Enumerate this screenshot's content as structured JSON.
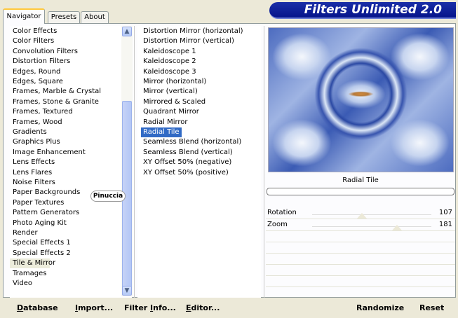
{
  "tabs": [
    {
      "label": "Navigator",
      "active": true
    },
    {
      "label": "Presets",
      "active": false
    },
    {
      "label": "About",
      "active": false
    }
  ],
  "banner": {
    "title": "Filters Unlimited 2.0"
  },
  "categories": [
    "Color Effects",
    "Color Filters",
    "Convolution Filters",
    "Distortion Filters",
    "Edges, Round",
    "Edges, Square",
    "Frames, Marble & Crystal",
    "Frames, Stone & Granite",
    "Frames, Textured",
    "Frames, Wood",
    "Gradients",
    "Graphics Plus",
    "Image Enhancement",
    "Lens Effects",
    "Lens Flares",
    "Noise Filters",
    "Paper Backgrounds",
    "Paper Textures",
    "Pattern Generators",
    "Photo Aging Kit",
    "Render",
    "Special Effects 1",
    "Special Effects 2",
    "Tile & Mirror",
    "Tramages",
    "Video"
  ],
  "selected_category": "Tile & Mirror",
  "filters": [
    "Distortion Mirror (horizontal)",
    "Distortion Mirror (vertical)",
    "Kaleidoscope 1",
    "Kaleidoscope 2",
    "Kaleidoscope 3",
    "Mirror (horizontal)",
    "Mirror (vertical)",
    "Mirrored & Scaled",
    "Quadrant Mirror",
    "Radial Mirror",
    "Radial Tile",
    "Seamless Blend (horizontal)",
    "Seamless Blend (vertical)",
    "XY Offset 50% (negative)",
    "XY Offset 50% (positive)"
  ],
  "selected_filter": "Radial Tile",
  "preview": {
    "label": "Radial Tile"
  },
  "watermark": "Pinuccia",
  "params": [
    {
      "label": "Rotation",
      "value": "107",
      "level": 0.42
    },
    {
      "label": "Zoom",
      "value": "181",
      "level": 0.71
    }
  ],
  "buttons": {
    "database": {
      "label": "Database",
      "key": "D",
      "rest": "atabase"
    },
    "import": {
      "label": "Import...",
      "key": "I",
      "rest": "mport..."
    },
    "filter_info": {
      "label": "Filter Info...",
      "pre": "Filter ",
      "key": "I",
      "rest": "nfo..."
    },
    "editor": {
      "label": "Editor...",
      "key": "E",
      "rest": "ditor..."
    },
    "randomize": {
      "label": "Randomize"
    },
    "reset": {
      "label": "Reset"
    }
  },
  "colors": {
    "selection": "#316ac5",
    "banner": "#06148a",
    "tab_accent": "#ffc83c"
  }
}
